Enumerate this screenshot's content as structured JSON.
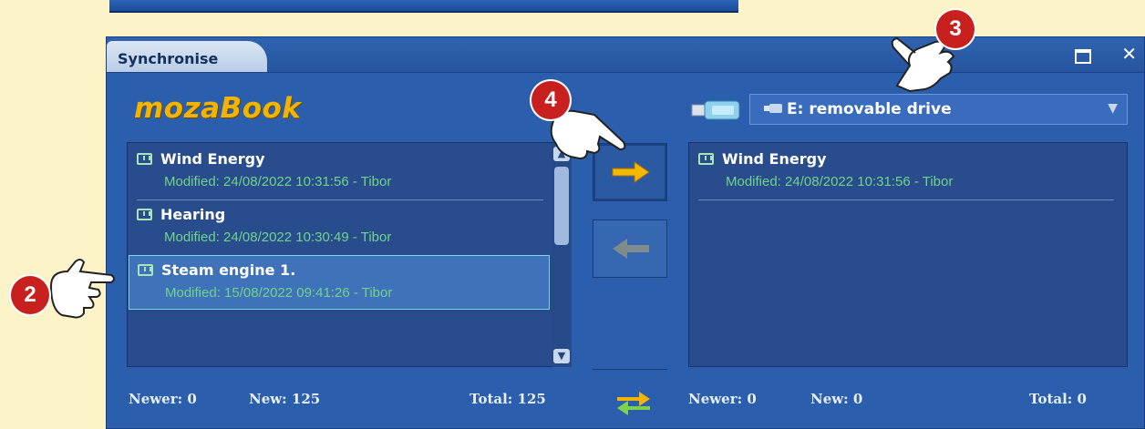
{
  "window": {
    "title": "Synchronise"
  },
  "logo": {
    "text": "mozaBook"
  },
  "left_list": {
    "items": [
      {
        "name": "Wind Energy",
        "modified": "Modified: 24/08/2022 10:31:56 - Tibor"
      },
      {
        "name": "Hearing",
        "modified": "Modified: 24/08/2022 10:30:49 - Tibor"
      },
      {
        "name": "Steam engine 1.",
        "modified": "Modified: 15/08/2022 09:41:26 - Tibor",
        "selected": true
      }
    ],
    "stats": {
      "newer": "Newer: 0",
      "new": "New: 125",
      "total": "Total: 125"
    }
  },
  "right_list": {
    "items": [
      {
        "name": "Wind Energy",
        "modified": "Modified: 24/08/2022 10:31:56 - Tibor"
      }
    ],
    "stats": {
      "newer": "Newer: 0",
      "new": "New: 0",
      "total": "Total: 0"
    }
  },
  "drive_select": {
    "value": "E: removable drive"
  },
  "annotations": {
    "badge2": "2",
    "badge3": "3",
    "badge4": "4"
  },
  "colors": {
    "accent": "#f2b400",
    "window_bg": "#2b5fae",
    "modified_text": "#6fd48c",
    "badge": "#c8201e"
  },
  "icons": [
    "book-icon",
    "usb-drive-icon",
    "arrow-right-icon",
    "arrow-left-icon",
    "sync-icon",
    "maximize-icon",
    "close-icon",
    "pointing-hand-icon"
  ]
}
